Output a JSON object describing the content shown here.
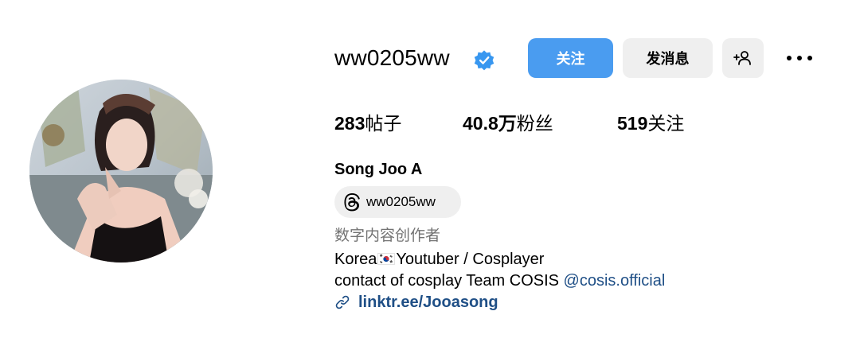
{
  "profile": {
    "username": "ww0205ww",
    "verified": true,
    "full_name": "Song Joo A",
    "category": "数字内容创作者",
    "threads_handle": "ww0205ww",
    "bio_line1_prefix": "Korea",
    "bio_line1_suffix": "Youtuber / Cosplayer",
    "bio_line2_text": "contact of cosplay Team COSIS ",
    "bio_line2_mention": "@cosis.official",
    "link_text": "linktr.ee/Jooasong"
  },
  "actions": {
    "follow_label": "关注",
    "message_label": "发消息"
  },
  "stats": {
    "posts_value": "283",
    "posts_label": "帖子",
    "followers_value": "40.8万",
    "followers_label": "粉丝",
    "following_value": "519",
    "following_label": "关注"
  },
  "colors": {
    "accent": "#4a9cf0",
    "verified_badge": "#3897f0",
    "button_gray": "#efefef",
    "link": "#1f4f86",
    "muted_text": "#737373"
  },
  "icons": {
    "verified": "verified-badge-icon",
    "add_user": "add-user-icon",
    "more": "more-horizontal-icon",
    "threads": "threads-icon",
    "link": "link-icon",
    "flag": "south-korea-flag-icon"
  }
}
